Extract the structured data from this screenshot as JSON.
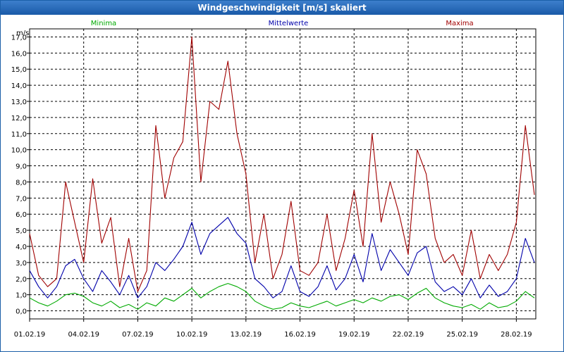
{
  "window": {
    "title": "Windgeschwindigkeit [m/s] skaliert"
  },
  "colors": {
    "minima": "#00aa00",
    "mittelwerte": "#0000aa",
    "maxima": "#a00000",
    "grid": "#000000",
    "titlebar": "#1a5aa8"
  },
  "chart_data": {
    "type": "line",
    "title": "Windgeschwindigkeit [m/s] skaliert",
    "ylabel": "m/s",
    "xlabel": "",
    "ylim": [
      -0.5,
      17.5
    ],
    "xlim": [
      1,
      29.08
    ],
    "y_ticks": [
      0,
      1,
      2,
      3,
      4,
      5,
      6,
      7,
      8,
      9,
      10,
      11,
      12,
      13,
      14,
      15,
      16,
      17
    ],
    "y_tick_labels": [
      "0,0",
      "1,0",
      "2,0",
      "3,0",
      "4,0",
      "5,0",
      "6,0",
      "7,0",
      "8,0",
      "9,0",
      "10,0",
      "11,0",
      "12,0",
      "13,0",
      "14,0",
      "15,0",
      "16,0",
      "17,0"
    ],
    "x_ticks": [
      1,
      4,
      7,
      10,
      13,
      16,
      19,
      22,
      25,
      28
    ],
    "x_tick_labels": [
      "01.02.19",
      "04.02.19",
      "07.02.19",
      "10.02.19",
      "13.02.19",
      "16.02.19",
      "19.02.19",
      "22.02.19",
      "25.02.19",
      "28.02.19"
    ],
    "x_grid": [
      4,
      7,
      10,
      13,
      16,
      19,
      22,
      25,
      28
    ],
    "grid": true,
    "legend_position": "top",
    "series": [
      {
        "name": "Minima",
        "color": "#00aa00",
        "x": [
          1,
          1.5,
          2,
          2.5,
          3,
          3.5,
          4,
          4.5,
          5,
          5.5,
          6,
          6.5,
          7,
          7.5,
          8,
          8.5,
          9,
          9.5,
          10,
          10.5,
          11,
          11.5,
          12,
          12.5,
          13,
          13.5,
          14,
          14.5,
          15,
          15.5,
          16,
          16.5,
          17,
          17.5,
          18,
          18.5,
          19,
          19.5,
          20,
          20.5,
          21,
          21.5,
          22,
          22.5,
          23,
          23.5,
          24,
          24.5,
          25,
          25.5,
          26,
          26.5,
          27,
          27.5,
          28,
          28.5,
          29
        ],
        "values": [
          0.8,
          0.5,
          0.3,
          0.6,
          1.0,
          1.1,
          0.9,
          0.5,
          0.3,
          0.6,
          0.2,
          0.4,
          0.1,
          0.5,
          0.3,
          0.8,
          0.6,
          1.0,
          1.4,
          0.8,
          1.2,
          1.5,
          1.7,
          1.5,
          1.2,
          0.6,
          0.3,
          0.1,
          0.2,
          0.5,
          0.3,
          0.2,
          0.4,
          0.6,
          0.3,
          0.5,
          0.7,
          0.5,
          0.8,
          0.6,
          0.9,
          1.0,
          0.7,
          1.1,
          1.4,
          0.8,
          0.5,
          0.3,
          0.2,
          0.4,
          0.1,
          0.5,
          0.2,
          0.3,
          0.6,
          1.2,
          0.8
        ]
      },
      {
        "name": "Mittelwerte",
        "color": "#0000aa",
        "x": [
          1,
          1.5,
          2,
          2.5,
          3,
          3.5,
          4,
          4.5,
          5,
          5.5,
          6,
          6.5,
          7,
          7.5,
          8,
          8.5,
          9,
          9.5,
          10,
          10.5,
          11,
          11.5,
          12,
          12.5,
          13,
          13.5,
          14,
          14.5,
          15,
          15.5,
          16,
          16.5,
          17,
          17.5,
          18,
          18.5,
          19,
          19.5,
          20,
          20.5,
          21,
          21.5,
          22,
          22.5,
          23,
          23.5,
          24,
          24.5,
          25,
          25.5,
          26,
          26.5,
          27,
          27.5,
          28,
          28.5,
          29
        ],
        "values": [
          2.5,
          1.5,
          0.8,
          1.5,
          2.8,
          3.2,
          2.0,
          1.2,
          2.5,
          1.8,
          1.0,
          2.2,
          0.8,
          1.5,
          3.0,
          2.5,
          3.2,
          4.0,
          5.5,
          3.5,
          4.8,
          5.3,
          5.8,
          4.8,
          4.2,
          2.0,
          1.5,
          0.8,
          1.2,
          2.8,
          1.2,
          0.9,
          1.5,
          2.8,
          1.3,
          2.0,
          3.5,
          1.8,
          4.8,
          2.5,
          3.8,
          3.0,
          2.2,
          3.6,
          4.0,
          1.8,
          1.2,
          1.5,
          1.0,
          2.0,
          0.8,
          1.6,
          0.9,
          1.2,
          2.0,
          4.5,
          3.0
        ]
      },
      {
        "name": "Maxima",
        "color": "#a00000",
        "x": [
          1,
          1.5,
          2,
          2.5,
          3,
          3.5,
          4,
          4.5,
          5,
          5.5,
          6,
          6.5,
          7,
          7.5,
          8,
          8.5,
          9,
          9.5,
          10,
          10.5,
          11,
          11.5,
          12,
          12.5,
          13,
          13.5,
          14,
          14.5,
          15,
          15.5,
          16,
          16.5,
          17,
          17.5,
          18,
          18.5,
          19,
          19.5,
          20,
          20.5,
          21,
          21.5,
          22,
          22.5,
          23,
          23.5,
          24,
          24.5,
          25,
          25.5,
          26,
          26.5,
          27,
          27.5,
          28,
          28.5,
          29
        ],
        "values": [
          4.8,
          2.2,
          1.5,
          2.0,
          8.0,
          5.5,
          3.0,
          8.2,
          4.2,
          5.8,
          1.5,
          4.5,
          1.2,
          2.5,
          11.5,
          7.0,
          9.5,
          10.5,
          17.0,
          8.0,
          13.0,
          12.5,
          15.5,
          11.0,
          8.5,
          3.0,
          6.0,
          2.0,
          3.5,
          6.8,
          2.5,
          2.2,
          3.0,
          6.0,
          2.5,
          4.5,
          7.5,
          4.0,
          11.0,
          5.5,
          8.0,
          6.0,
          3.5,
          10.0,
          8.5,
          4.5,
          3.0,
          3.5,
          2.2,
          5.0,
          2.0,
          3.5,
          2.5,
          3.5,
          5.5,
          11.5,
          7.2
        ]
      }
    ]
  }
}
